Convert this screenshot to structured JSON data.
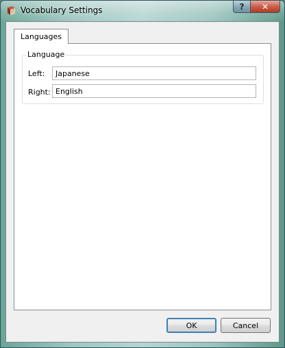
{
  "window": {
    "title": "Vocabulary Settings",
    "help_symbol": "?",
    "close_symbol": "✕"
  },
  "tabs": [
    {
      "label": "Languages",
      "selected": true
    }
  ],
  "language_group": {
    "title": "Language",
    "left_label": "Left:",
    "left_value": "Japanese",
    "right_label": "Right:",
    "right_value": "English"
  },
  "buttons": {
    "ok": "OK",
    "cancel": "Cancel"
  },
  "colors": {
    "close_button": "#c9604c",
    "ok_focus_border": "#3c7fb1"
  }
}
